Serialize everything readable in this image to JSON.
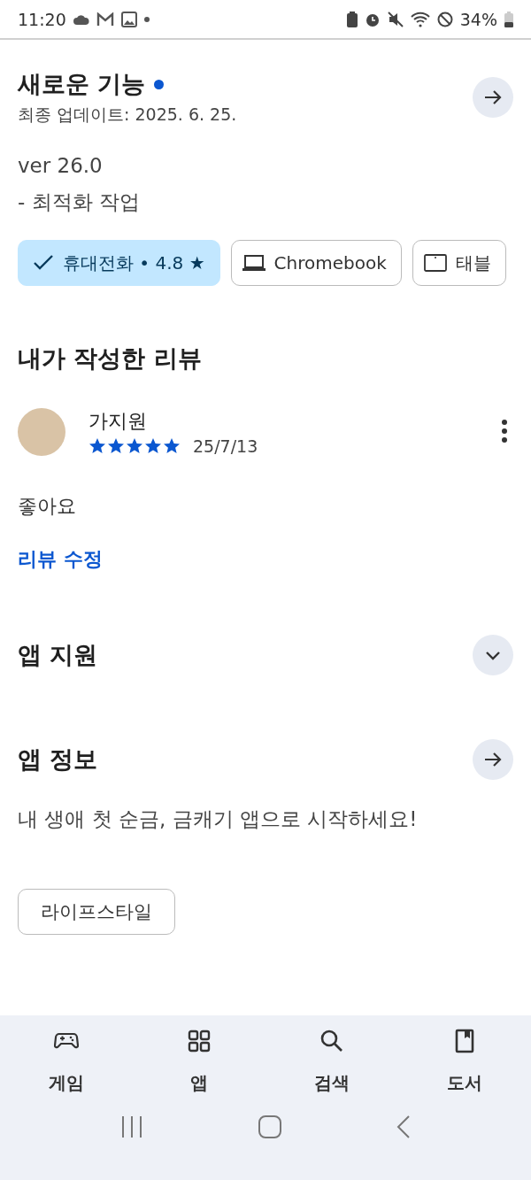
{
  "status_bar": {
    "time": "11:20",
    "battery": "34%"
  },
  "whats_new": {
    "title": "새로운 기능",
    "new_dot": true,
    "updated": "최종 업데이트: 2025. 6. 25.",
    "lines": [
      "ver 26.0",
      "- 최적화 작업"
    ]
  },
  "devices": [
    {
      "kind": "phone",
      "label": "휴대전화 • 4.8 ★",
      "selected": true
    },
    {
      "kind": "laptop",
      "label": "Chromebook",
      "selected": false
    },
    {
      "kind": "tablet",
      "label": "태블",
      "selected": false
    }
  ],
  "my_review": {
    "heading": "내가 작성한 리뷰",
    "author": "가지원",
    "stars": 5,
    "date": "25/7/13",
    "text": "좋아요",
    "edit_link": "리뷰 수정"
  },
  "app_support": {
    "title": "앱 지원",
    "expanded": false
  },
  "app_info": {
    "title": "앱 정보",
    "description": "내 생애 첫 순금, 금캐기 앱으로 시작하세요!",
    "tags": [
      "라이프스타일"
    ]
  },
  "bottom_nav": [
    {
      "kind": "games",
      "label": "게임"
    },
    {
      "kind": "apps",
      "label": "앱"
    },
    {
      "kind": "search",
      "label": "검색"
    },
    {
      "kind": "books",
      "label": "도서"
    }
  ]
}
